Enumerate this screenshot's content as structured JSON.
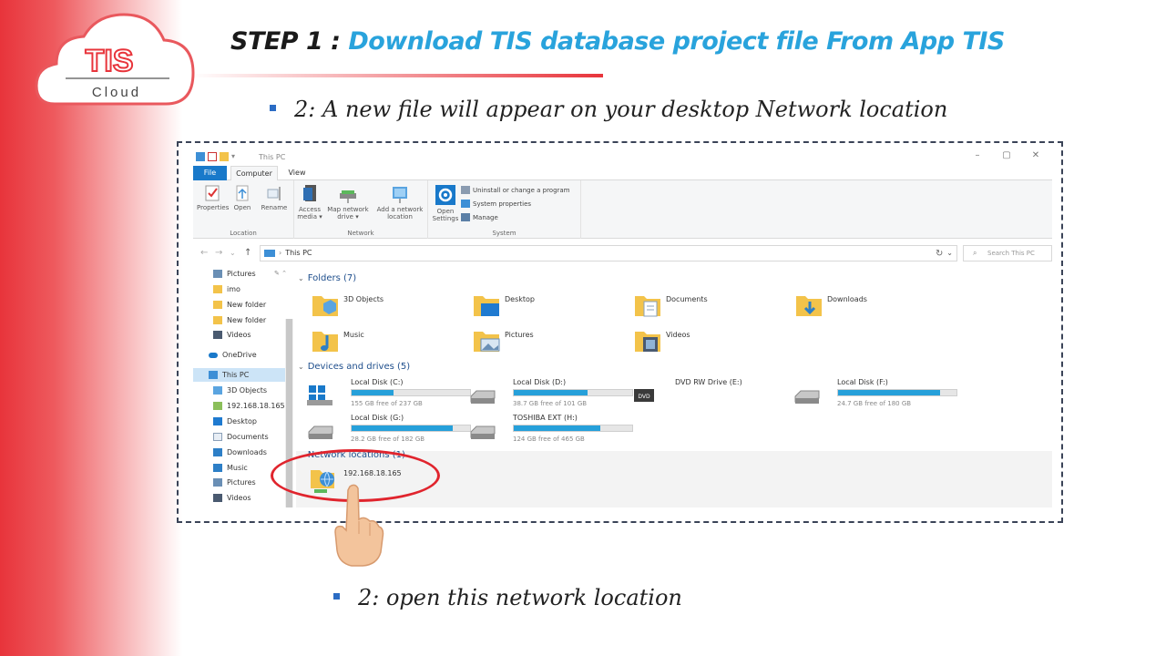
{
  "colors": {
    "accent_red": "#e8343b",
    "accent_blue": "#29a3dc",
    "windows_blue": "#1979ca",
    "bar_fill": "#26a0da"
  },
  "logo": {
    "text": "TIS",
    "sub": "Cloud"
  },
  "slide": {
    "title_prefix": "STEP 1 : ",
    "title_main": "Download TIS database project file From App TIS",
    "bullet_top": "2: A new file will appear on your desktop Network location",
    "bullet_bottom": "2: open this network location"
  },
  "explorer": {
    "window_title": "This PC",
    "window_controls": [
      "–",
      "▢",
      "✕"
    ],
    "tabs": {
      "file": "File",
      "computer": "Computer",
      "view": "View"
    },
    "ribbon": {
      "location": {
        "label": "Location",
        "properties": "Properties",
        "open": "Open",
        "rename": "Rename"
      },
      "network": {
        "label": "Network",
        "access_media": "Access media ▾",
        "map_drive": "Map network drive ▾",
        "add_location": "Add a network location"
      },
      "system": {
        "label": "System",
        "open_settings": "Open Settings",
        "uninstall": "Uninstall or change a program",
        "system_properties": "System properties",
        "manage": "Manage"
      }
    },
    "address": {
      "path": "This PC",
      "search_placeholder": "Search This PC",
      "back": "←",
      "forward": "→",
      "down": "⌄",
      "up": "↑",
      "refresh": "↻",
      "dropdown": "⌄"
    },
    "nav": {
      "items": [
        {
          "label": "Pictures",
          "icon": "pictures-icon"
        },
        {
          "label": "imo",
          "icon": "folder-icon"
        },
        {
          "label": "New folder",
          "icon": "folder-icon"
        },
        {
          "label": "New folder",
          "icon": "folder-icon"
        },
        {
          "label": "Videos",
          "icon": "videos-icon"
        },
        {
          "label": "OneDrive",
          "icon": "onedrive-icon"
        },
        {
          "label": "This PC",
          "icon": "pc-icon"
        },
        {
          "label": "3D Objects",
          "icon": "3d-objects-icon"
        },
        {
          "label": "192.168.18.165",
          "icon": "network-location-icon"
        },
        {
          "label": "Desktop",
          "icon": "desktop-icon"
        },
        {
          "label": "Documents",
          "icon": "documents-icon"
        },
        {
          "label": "Downloads",
          "icon": "downloads-icon"
        },
        {
          "label": "Music",
          "icon": "music-icon"
        },
        {
          "label": "Pictures",
          "icon": "pictures-icon"
        },
        {
          "label": "Videos",
          "icon": "videos-icon"
        }
      ]
    },
    "sections": {
      "folders": "Folders (7)",
      "devices": "Devices and drives (5)",
      "network": "Network locations (1)"
    },
    "folders": [
      "3D Objects",
      "Desktop",
      "Documents",
      "Downloads",
      "Music",
      "Pictures",
      "Videos"
    ],
    "drives": [
      {
        "name": "Local Disk (C:)",
        "free": "155 GB free of 237 GB",
        "used_fraction": 0.35
      },
      {
        "name": "Local Disk (D:)",
        "free": "38.7 GB free of 101 GB",
        "used_fraction": 0.62
      },
      {
        "name": "DVD RW Drive (E:)"
      },
      {
        "name": "Local Disk (F:)",
        "free": "24.7 GB free of 180 GB",
        "used_fraction": 0.86
      },
      {
        "name": "Local Disk (G:)",
        "free": "28.2 GB free of 182 GB",
        "used_fraction": 0.85
      },
      {
        "name": "TOSHIBA EXT (H:)",
        "free": "124 GB free of 465 GB",
        "used_fraction": 0.73
      }
    ],
    "network_locations": [
      "192.168.18.165"
    ]
  }
}
